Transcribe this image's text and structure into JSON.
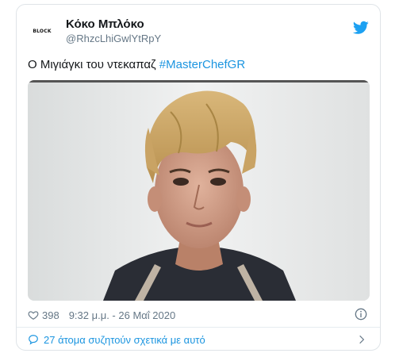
{
  "tweet": {
    "author": {
      "display_name": "Κόκο Μπλόκο",
      "handle": "@RhzcLhiGwlYtRpY",
      "avatar_text": "BLOCK"
    },
    "text": "Ο Μιγιάγκι του ντεκαπαζ",
    "hashtag": "#MasterChefGR",
    "likes": "398",
    "timestamp": "9:32 μ.μ. - 26 Μαΐ 2020",
    "conversation_link": "27 άτομα συζητούν σχετικά με αυτό"
  },
  "icons": {
    "brand": "twitter-bird-icon",
    "like": "heart-icon",
    "info": "info-icon",
    "conversation": "chat-bubble-icon",
    "next": "chevron-right-icon"
  },
  "colors": {
    "link": "#1b95e0",
    "twitter_brand": "#1da1f2",
    "muted_text": "#657786",
    "text": "#14171a"
  }
}
